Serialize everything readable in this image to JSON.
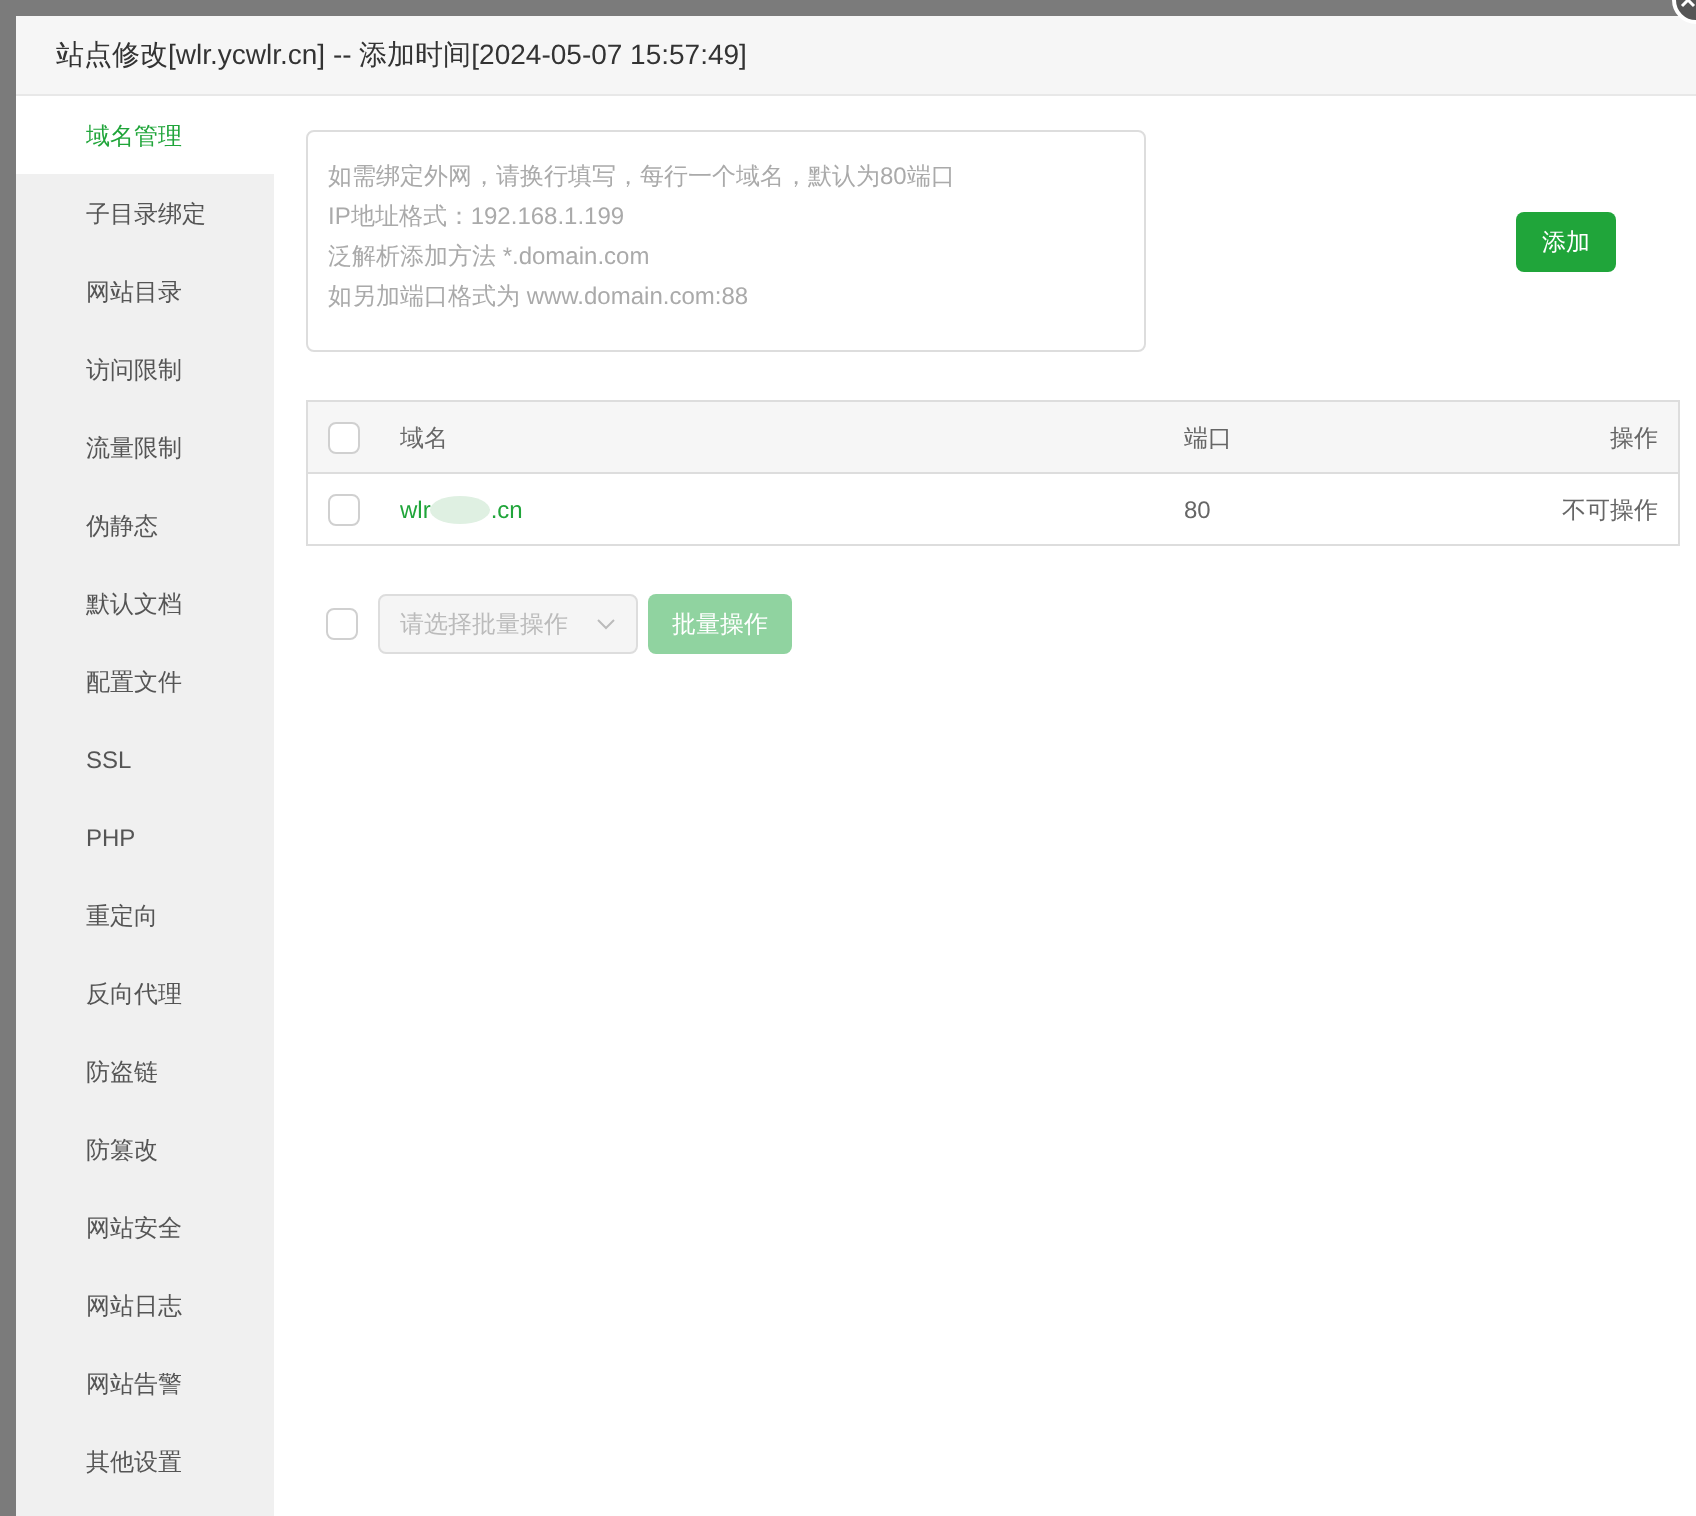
{
  "window": {
    "title": "站点修改[wlr.ycwlr.cn] -- 添加时间[2024-05-07 15:57:49]"
  },
  "sidebar": {
    "items": [
      {
        "label": "域名管理",
        "selected": true
      },
      {
        "label": "子目录绑定",
        "selected": false
      },
      {
        "label": "网站目录",
        "selected": false
      },
      {
        "label": "访问限制",
        "selected": false
      },
      {
        "label": "流量限制",
        "selected": false
      },
      {
        "label": "伪静态",
        "selected": false
      },
      {
        "label": "默认文档",
        "selected": false
      },
      {
        "label": "配置文件",
        "selected": false
      },
      {
        "label": "SSL",
        "selected": false
      },
      {
        "label": "PHP",
        "selected": false
      },
      {
        "label": "重定向",
        "selected": false
      },
      {
        "label": "反向代理",
        "selected": false
      },
      {
        "label": "防盗链",
        "selected": false
      },
      {
        "label": "防篡改",
        "selected": false
      },
      {
        "label": "网站安全",
        "selected": false
      },
      {
        "label": "网站日志",
        "selected": false
      },
      {
        "label": "网站告警",
        "selected": false
      },
      {
        "label": "其他设置",
        "selected": false
      }
    ]
  },
  "domain_input": {
    "placeholder_lines": [
      "如需绑定外网，请换行填写，每行一个域名，默认为80端口",
      "IP地址格式：192.168.1.199",
      "泛解析添加方法 *.domain.com",
      "如另加端口格式为 www.domain.com:88"
    ]
  },
  "add_button": "添加",
  "table": {
    "columns": [
      "域名",
      "端口",
      "操作"
    ],
    "header_checked": false,
    "rows": [
      {
        "checked": false,
        "domain_start": "wlr",
        "domain_end": ".cn",
        "port": "80",
        "action": "不可操作"
      }
    ]
  },
  "batch": {
    "checked": false,
    "placeholder": "请选择批量操作",
    "button": "批量操作",
    "disabled": true
  }
}
